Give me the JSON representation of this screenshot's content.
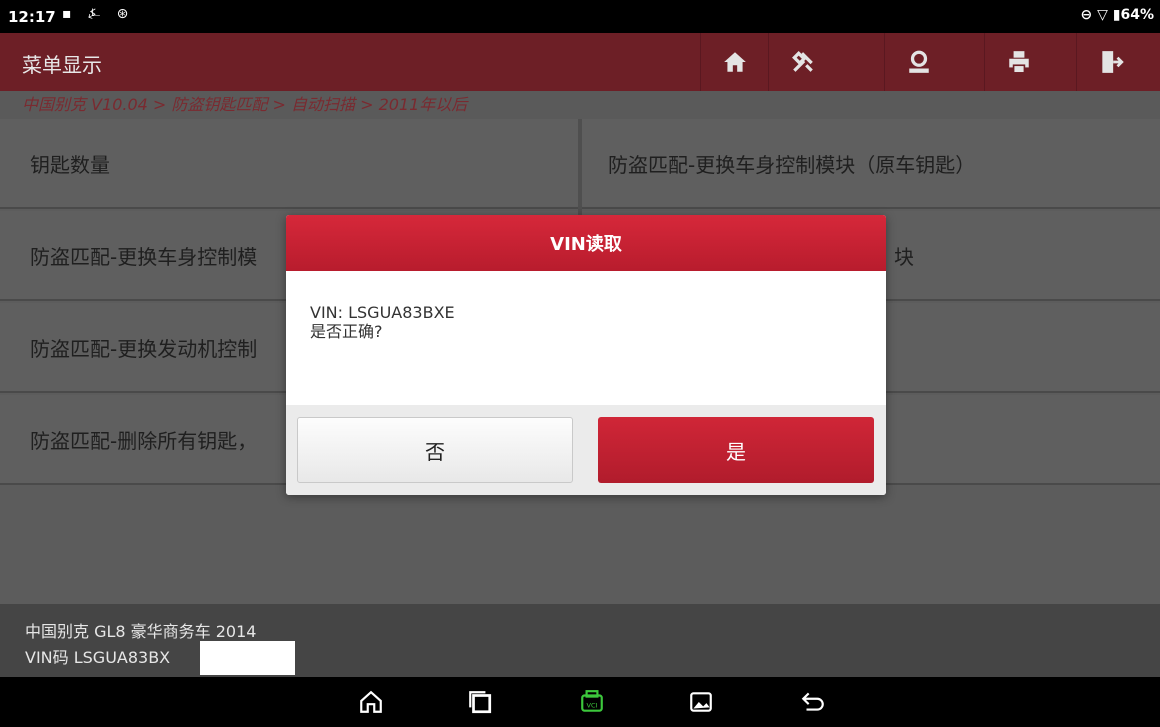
{
  "status": {
    "time": "12:17",
    "battery": "64%"
  },
  "header": {
    "title": "菜单显示",
    "toolbar": [
      "home-icon",
      "diagnose-tools-icon",
      "user-icon",
      "print-icon",
      "exit-icon"
    ]
  },
  "breadcrumb": "中国别克 V10.04 > 防盗钥匙匹配 > 自动扫描 > 2011年以后",
  "menu": {
    "items": [
      "钥匙数量",
      "防盗匹配-更换车身控制模块（原车钥匙）",
      "防盗匹配-更换车身控制模",
      "块",
      "防盗匹配-更换发动机控制",
      "",
      "防盗匹配-删除所有钥匙，",
      ""
    ]
  },
  "dialog": {
    "title": "VIN读取",
    "line1": "VIN: LSGUA83BXE",
    "line2": "是否正确?",
    "no_label": "否",
    "yes_label": "是"
  },
  "footer": {
    "vehicle": "中国别克 GL8 豪华商务车 2014",
    "vin": "VIN码 LSGUA83BX"
  },
  "colors": {
    "header": "#6d1f26",
    "accent": "#c0202f"
  }
}
